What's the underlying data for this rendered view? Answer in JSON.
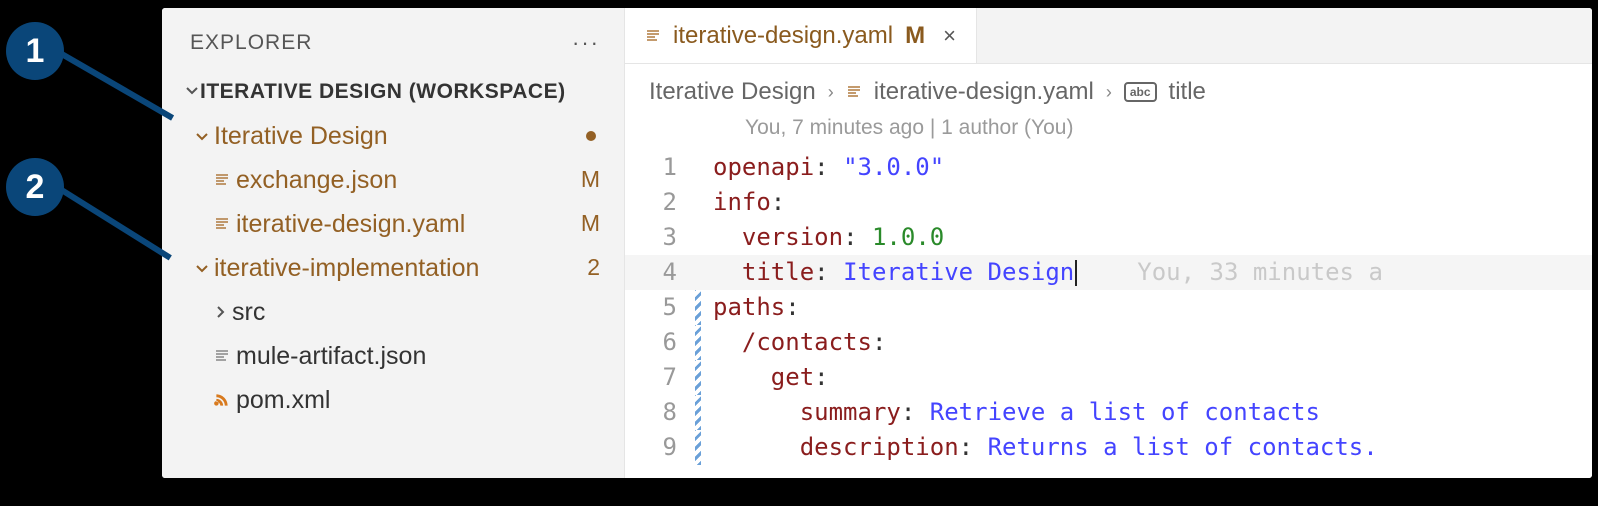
{
  "annotations": {
    "one": "1",
    "two": "2"
  },
  "sidebar": {
    "title": "EXPLORER",
    "more": "···",
    "workspace": "ITERATIVE DESIGN (WORKSPACE)",
    "items": [
      {
        "label": "Iterative Design",
        "badge": "",
        "depth": 0,
        "expandable": true,
        "dot": true,
        "dark": false
      },
      {
        "label": "exchange.json",
        "badge": "M",
        "depth": 1,
        "icon": "lines",
        "dark": false
      },
      {
        "label": "iterative-design.yaml",
        "badge": "M",
        "depth": 1,
        "icon": "lines",
        "dark": false
      },
      {
        "label": "iterative-implementation",
        "badge": "2",
        "depth": 0,
        "expandable": true,
        "dark": false
      },
      {
        "label": "src",
        "badge": "",
        "depth": 1,
        "expandable": true,
        "collapsed": true,
        "dark": true
      },
      {
        "label": "mule-artifact.json",
        "badge": "",
        "depth": 1,
        "icon": "lines",
        "dark": true
      },
      {
        "label": "pom.xml",
        "badge": "",
        "depth": 1,
        "icon": "rss",
        "dark": true
      }
    ]
  },
  "tab": {
    "name": "iterative-design.yaml",
    "modified": "M",
    "close": "×"
  },
  "breadcrumbs": {
    "root": "Iterative Design",
    "file": "iterative-design.yaml",
    "symbol": "title",
    "sep": "›"
  },
  "codelens": "You, 7 minutes ago | 1 author (You)",
  "code": {
    "lines": [
      {
        "n": "1",
        "segs": [
          {
            "t": "openapi",
            "c": "key"
          },
          {
            "t": ": ",
            "c": "plain"
          },
          {
            "t": "\"3.0.0\"",
            "c": "quoted"
          }
        ]
      },
      {
        "n": "2",
        "segs": [
          {
            "t": "info",
            "c": "key"
          },
          {
            "t": ":",
            "c": "plain"
          }
        ]
      },
      {
        "n": "3",
        "segs": [
          {
            "t": "  ",
            "c": "plain"
          },
          {
            "t": "version",
            "c": "key"
          },
          {
            "t": ": ",
            "c": "plain"
          },
          {
            "t": "1.0.0",
            "c": "strg"
          }
        ]
      },
      {
        "n": "4",
        "hl": true,
        "segs": [
          {
            "t": "  ",
            "c": "plain"
          },
          {
            "t": "title",
            "c": "key"
          },
          {
            "t": ": ",
            "c": "plain"
          },
          {
            "t": "Iterative Design",
            "c": "str"
          }
        ],
        "cursor": true,
        "ghost": "You, 33 minutes a"
      },
      {
        "n": "5",
        "bar": true,
        "segs": [
          {
            "t": "paths",
            "c": "key"
          },
          {
            "t": ":",
            "c": "plain"
          }
        ]
      },
      {
        "n": "6",
        "bar": true,
        "segs": [
          {
            "t": "  ",
            "c": "plain"
          },
          {
            "t": "/contacts",
            "c": "key"
          },
          {
            "t": ":",
            "c": "plain"
          }
        ]
      },
      {
        "n": "7",
        "bar": true,
        "segs": [
          {
            "t": "    ",
            "c": "plain"
          },
          {
            "t": "get",
            "c": "key"
          },
          {
            "t": ":",
            "c": "plain"
          }
        ]
      },
      {
        "n": "8",
        "bar": true,
        "segs": [
          {
            "t": "      ",
            "c": "plain"
          },
          {
            "t": "summary",
            "c": "key"
          },
          {
            "t": ": ",
            "c": "plain"
          },
          {
            "t": "Retrieve a list of contacts",
            "c": "str"
          }
        ]
      },
      {
        "n": "9",
        "bar": true,
        "segs": [
          {
            "t": "      ",
            "c": "plain"
          },
          {
            "t": "description",
            "c": "key"
          },
          {
            "t": ": ",
            "c": "plain"
          },
          {
            "t": "Returns a list of contacts.",
            "c": "str"
          }
        ]
      }
    ]
  }
}
